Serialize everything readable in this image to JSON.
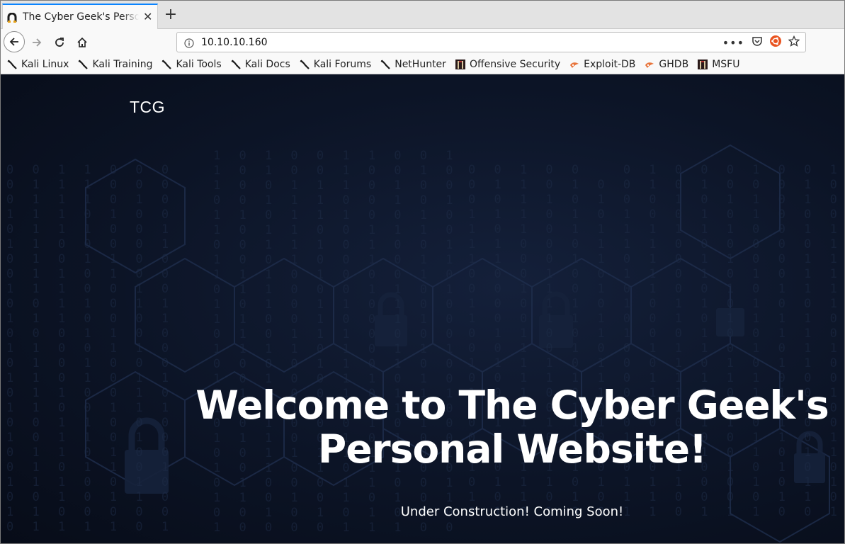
{
  "browser": {
    "tab": {
      "title": "The Cyber Geek's Personal Website"
    },
    "url": "10.10.10.160",
    "bookmarks": [
      {
        "label": "Kali Linux",
        "icon": "kali-dragon-icon"
      },
      {
        "label": "Kali Training",
        "icon": "kali-dragon-icon"
      },
      {
        "label": "Kali Tools",
        "icon": "kali-dragon-icon"
      },
      {
        "label": "Kali Docs",
        "icon": "kali-dragon-icon"
      },
      {
        "label": "Kali Forums",
        "icon": "kali-dragon-icon"
      },
      {
        "label": "NetHunter",
        "icon": "kali-dragon-icon"
      },
      {
        "label": "Offensive Security",
        "icon": "offsec-icon"
      },
      {
        "label": "Exploit-DB",
        "icon": "exploitdb-icon"
      },
      {
        "label": "GHDB",
        "icon": "exploitdb-icon"
      },
      {
        "label": "MSFU",
        "icon": "offsec-icon"
      }
    ]
  },
  "page": {
    "brand": "TCG",
    "hero_title_line1": "Welcome to The Cyber Geek's",
    "hero_title_line2": "Personal Website!",
    "hero_subtitle": "Under Construction! Coming Soon!"
  },
  "colors": {
    "accent": "#0a84ff",
    "page_bg": "#0c1426"
  }
}
